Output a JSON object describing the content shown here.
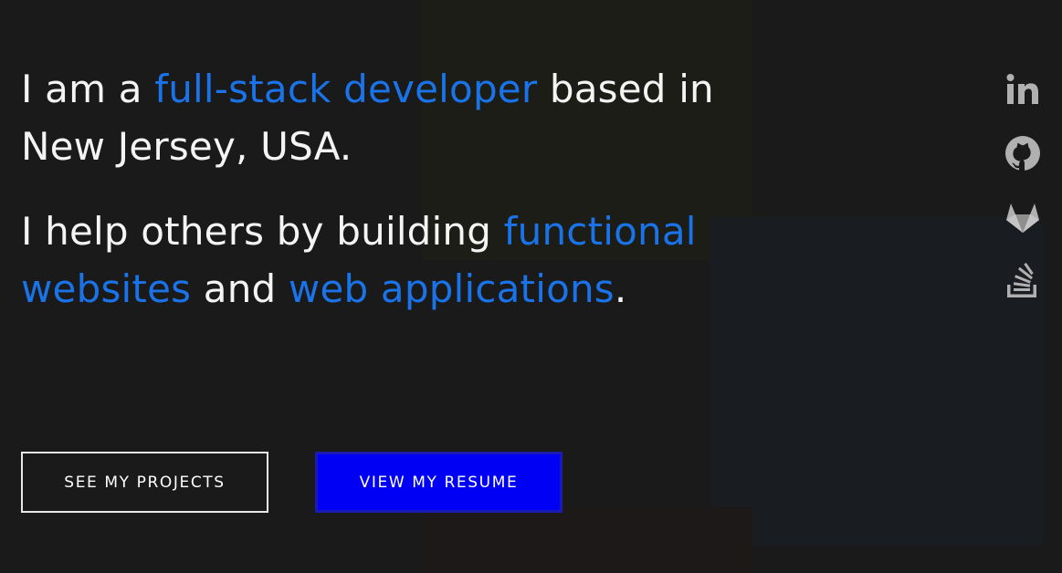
{
  "intro": {
    "line1": {
      "pre": "I am a ",
      "highlight": "full-stack developer",
      "post": " based in New Jersey, USA."
    },
    "line2": {
      "pre": "I help others by building ",
      "highlight1": "functional websites",
      "mid": " and ",
      "highlight2": "web applications",
      "post": "."
    }
  },
  "buttons": {
    "projects": "SEE MY PROJECTS",
    "resume": "VIEW MY RESUME"
  },
  "social": {
    "icons": [
      "linkedin-icon",
      "github-icon",
      "gitlab-icon",
      "stackoverflow-icon"
    ]
  },
  "colors": {
    "background": "#1a1a1a",
    "accent": "#1a73e8",
    "resume_button": "#0000f5",
    "icon": "#b0b0b0"
  }
}
